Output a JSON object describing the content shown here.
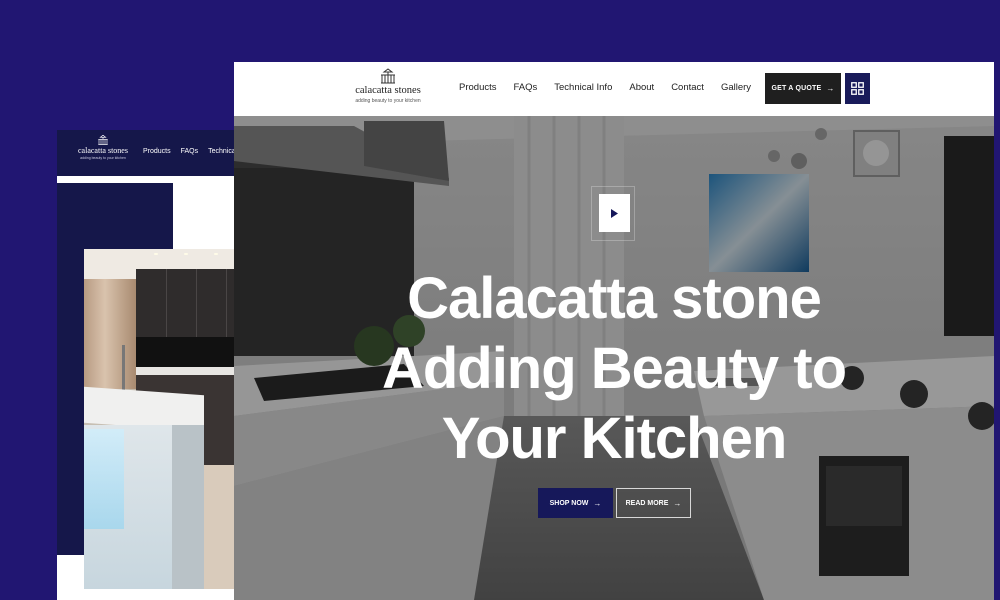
{
  "brand": {
    "name": "calacatta stones",
    "tagline": "adding beauty to your kitchen"
  },
  "nav": {
    "items": [
      {
        "label": "Products"
      },
      {
        "label": "FAQs"
      },
      {
        "label": "Technical Info"
      },
      {
        "label": "About"
      },
      {
        "label": "Contact"
      },
      {
        "label": "Gallery"
      }
    ]
  },
  "back_nav": {
    "items": [
      {
        "label": "Products"
      },
      {
        "label": "FAQs"
      },
      {
        "label": "Technical Info"
      }
    ]
  },
  "header": {
    "quote_label": "GET A QUOTE",
    "quote_icon": "arrow-right-icon",
    "menu_icon": "grid-icon"
  },
  "hero": {
    "title_lines": [
      "Calacatta stone",
      "Adding Beauty to",
      "Your Kitchen"
    ],
    "play_icon": "play-icon",
    "shop_label": "SHOP NOW",
    "read_label": "READ MORE"
  },
  "colors": {
    "page_background": "#211672",
    "navy_accent": "#16185a",
    "quote_button": "#1f1f1f",
    "hero_text": "#ffffff"
  }
}
